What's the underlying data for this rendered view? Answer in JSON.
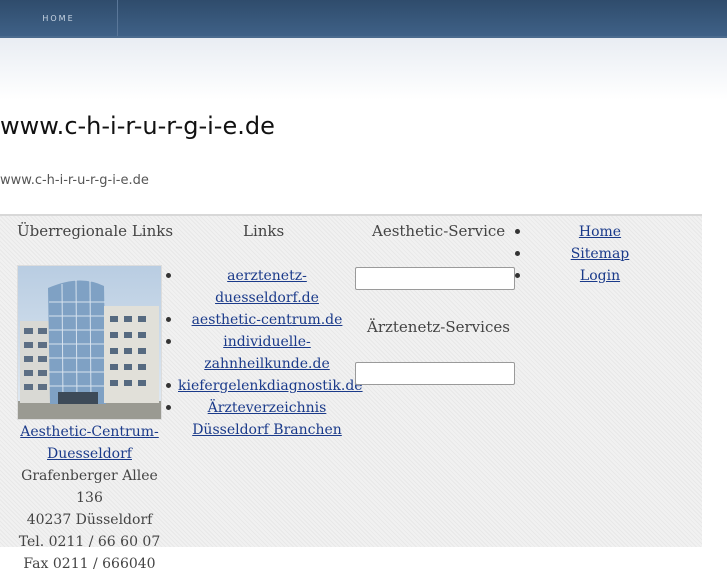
{
  "nav": {
    "home": "HOME"
  },
  "header": {
    "title": "www.c-h-i-r-u-r-g-i-e.de",
    "subtitle": "www.c-h-i-r-u-r-g-i-e.de"
  },
  "columns": {
    "ueberregional": {
      "heading": "Überregionale Links",
      "link_line1": "Aesthetic-Centrum-",
      "link_line2": "Duesseldorf",
      "address": [
        "Grafenberger Allee 136",
        "40237 Düsseldorf",
        "Tel. 0211 / 66 60 07",
        "Fax 0211 / 666040"
      ]
    },
    "links": {
      "heading": "Links",
      "items": [
        [
          "aerztenetz-",
          "duesseldorf.de"
        ],
        [
          "aesthetic-centrum.de"
        ],
        [
          "individuelle-",
          "zahnheilkunde.de"
        ],
        [
          "kiefergelenkdiagnostik.de"
        ],
        [
          "Ärzteverzeichnis",
          "Düsseldorf Branchen"
        ]
      ]
    },
    "aesthetic_service": {
      "heading": "Aesthetic-Service",
      "field_value": ""
    },
    "aerztenetz_services": {
      "heading": "Ärztenetz-Services",
      "field_value": ""
    },
    "menu": {
      "items": [
        "Home",
        "Sitemap",
        "Login"
      ]
    }
  }
}
